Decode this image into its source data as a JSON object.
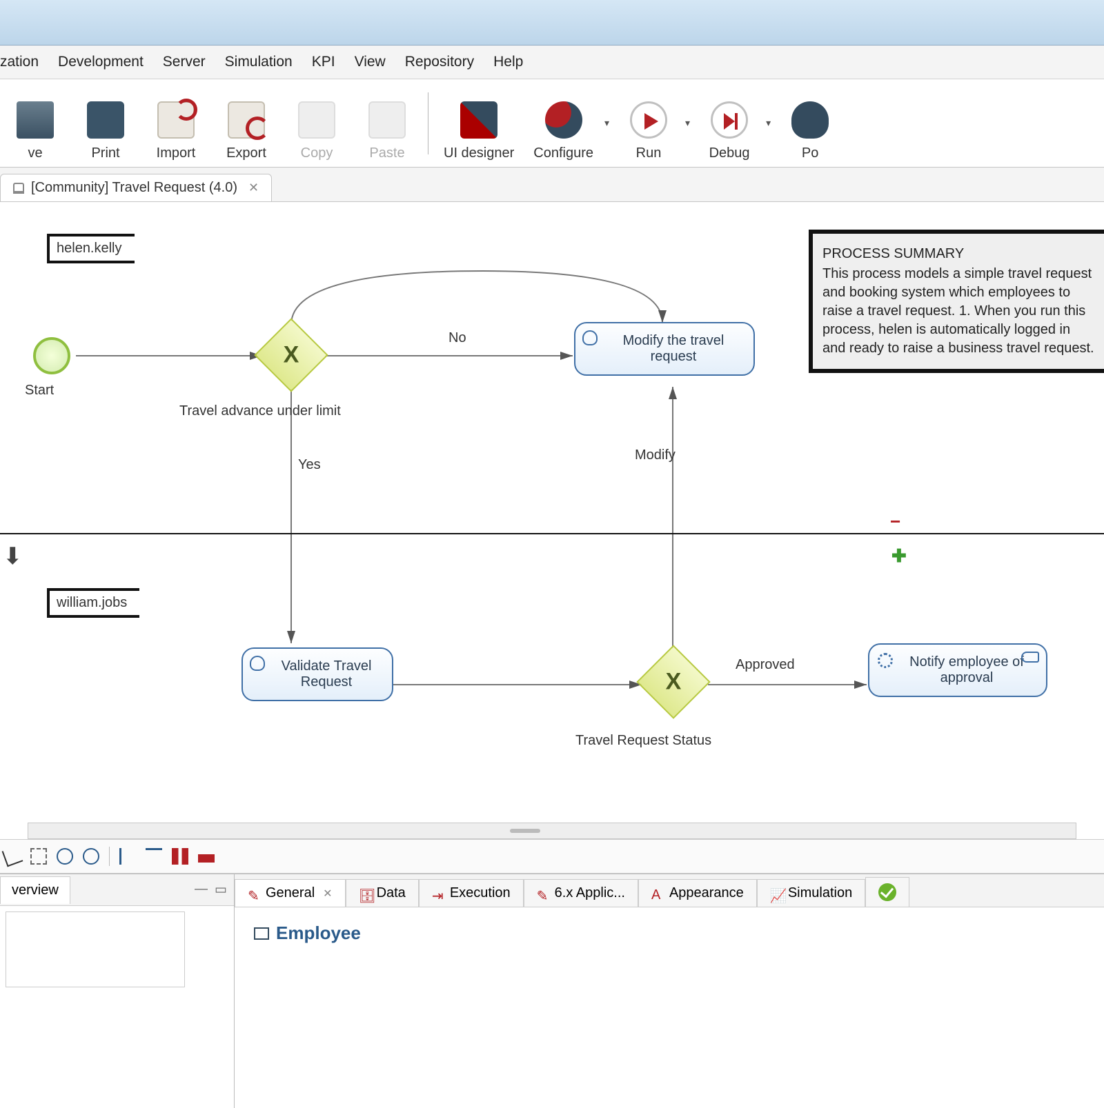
{
  "menubar": [
    "zation",
    "Development",
    "Server",
    "Simulation",
    "KPI",
    "View",
    "Repository",
    "Help"
  ],
  "toolbar": [
    {
      "key": "save",
      "label": "ve",
      "iconClass": "save",
      "enabled": true,
      "dropdown": false
    },
    {
      "key": "print",
      "label": "Print",
      "iconClass": "print",
      "enabled": true,
      "dropdown": false
    },
    {
      "key": "import",
      "label": "Import",
      "iconClass": "import",
      "enabled": true,
      "dropdown": false
    },
    {
      "key": "export",
      "label": "Export",
      "iconClass": "export",
      "enabled": true,
      "dropdown": false
    },
    {
      "key": "copy",
      "label": "Copy",
      "iconClass": "copy",
      "enabled": false,
      "dropdown": false
    },
    {
      "key": "paste",
      "label": "Paste",
      "iconClass": "paste",
      "enabled": false,
      "dropdown": false
    },
    {
      "key": "sep1",
      "sep": true
    },
    {
      "key": "uidesigner",
      "label": "UI designer",
      "iconClass": "uidesigner",
      "enabled": true,
      "dropdown": false
    },
    {
      "key": "configure",
      "label": "Configure",
      "iconClass": "configure",
      "enabled": true,
      "dropdown": true
    },
    {
      "key": "run",
      "label": "Run",
      "iconClass": "run",
      "enabled": true,
      "dropdown": true
    },
    {
      "key": "debug",
      "label": "Debug",
      "iconClass": "debug",
      "enabled": true,
      "dropdown": true
    },
    {
      "key": "po",
      "label": "Po",
      "iconClass": "po",
      "enabled": true,
      "dropdown": false
    }
  ],
  "editor_tab": {
    "title": "[Community] Travel Request (4.0)"
  },
  "diagram": {
    "lanes": [
      {
        "key": "lane1",
        "name": "helen.kelly"
      },
      {
        "key": "lane2",
        "name": "william.jobs"
      }
    ],
    "start_label": "Start",
    "gateways": [
      {
        "key": "gw1",
        "label": "Travel advance under limit"
      },
      {
        "key": "gw2",
        "label": "Travel Request Status"
      }
    ],
    "tasks": [
      {
        "key": "t_modify",
        "label": "Modify the travel request",
        "type": "user"
      },
      {
        "key": "t_validate",
        "label": "Validate Travel Request",
        "type": "user"
      },
      {
        "key": "t_notify",
        "label": "Notify employee of approval",
        "type": "service"
      }
    ],
    "flow_labels": {
      "no": "No",
      "yes": "Yes",
      "modify": "Modify",
      "approved": "Approved"
    },
    "annotation": {
      "heading": "PROCESS SUMMARY",
      "body": "This process models a simple travel request and booking system which employees  to raise a travel request. 1. When you run this process, helen is automatically logged in and ready to raise a business travel request."
    }
  },
  "overview_tab": "verview",
  "detail_tabs": [
    {
      "key": "general",
      "label": "General",
      "active": true,
      "closable": true
    },
    {
      "key": "data",
      "label": "Data"
    },
    {
      "key": "execution",
      "label": "Execution"
    },
    {
      "key": "6xapp",
      "label": "6.x Applic..."
    },
    {
      "key": "appearance",
      "label": "Appearance"
    },
    {
      "key": "simulation",
      "label": "Simulation"
    },
    {
      "key": "validate",
      "label": "",
      "check": true
    }
  ],
  "detail_section_title": "Employee"
}
